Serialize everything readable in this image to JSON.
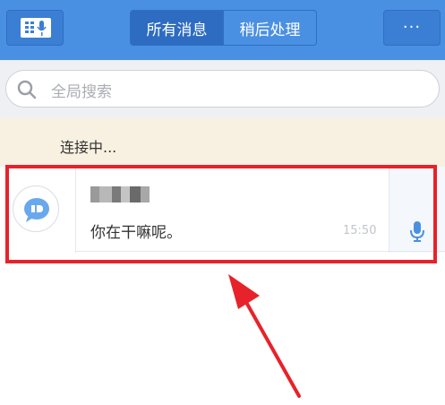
{
  "header": {
    "tabs": [
      {
        "label": "所有消息",
        "active": true
      },
      {
        "label": "稍后处理",
        "active": false
      }
    ],
    "more_label": "···"
  },
  "search": {
    "placeholder": "全局搜索"
  },
  "connection": {
    "status": "连接中..."
  },
  "conversation": {
    "message": "你在干嘛呢。",
    "time": "15:50"
  },
  "icons": {
    "voice_menu": "voice-menu-icon",
    "search": "search-icon",
    "avatar": "chat-bubble-icon",
    "mic": "microphone-icon"
  },
  "colors": {
    "header": "#4a90e2",
    "highlight": "#e8222a",
    "banner": "#f8f1e1",
    "mic": "#4a90e2"
  }
}
